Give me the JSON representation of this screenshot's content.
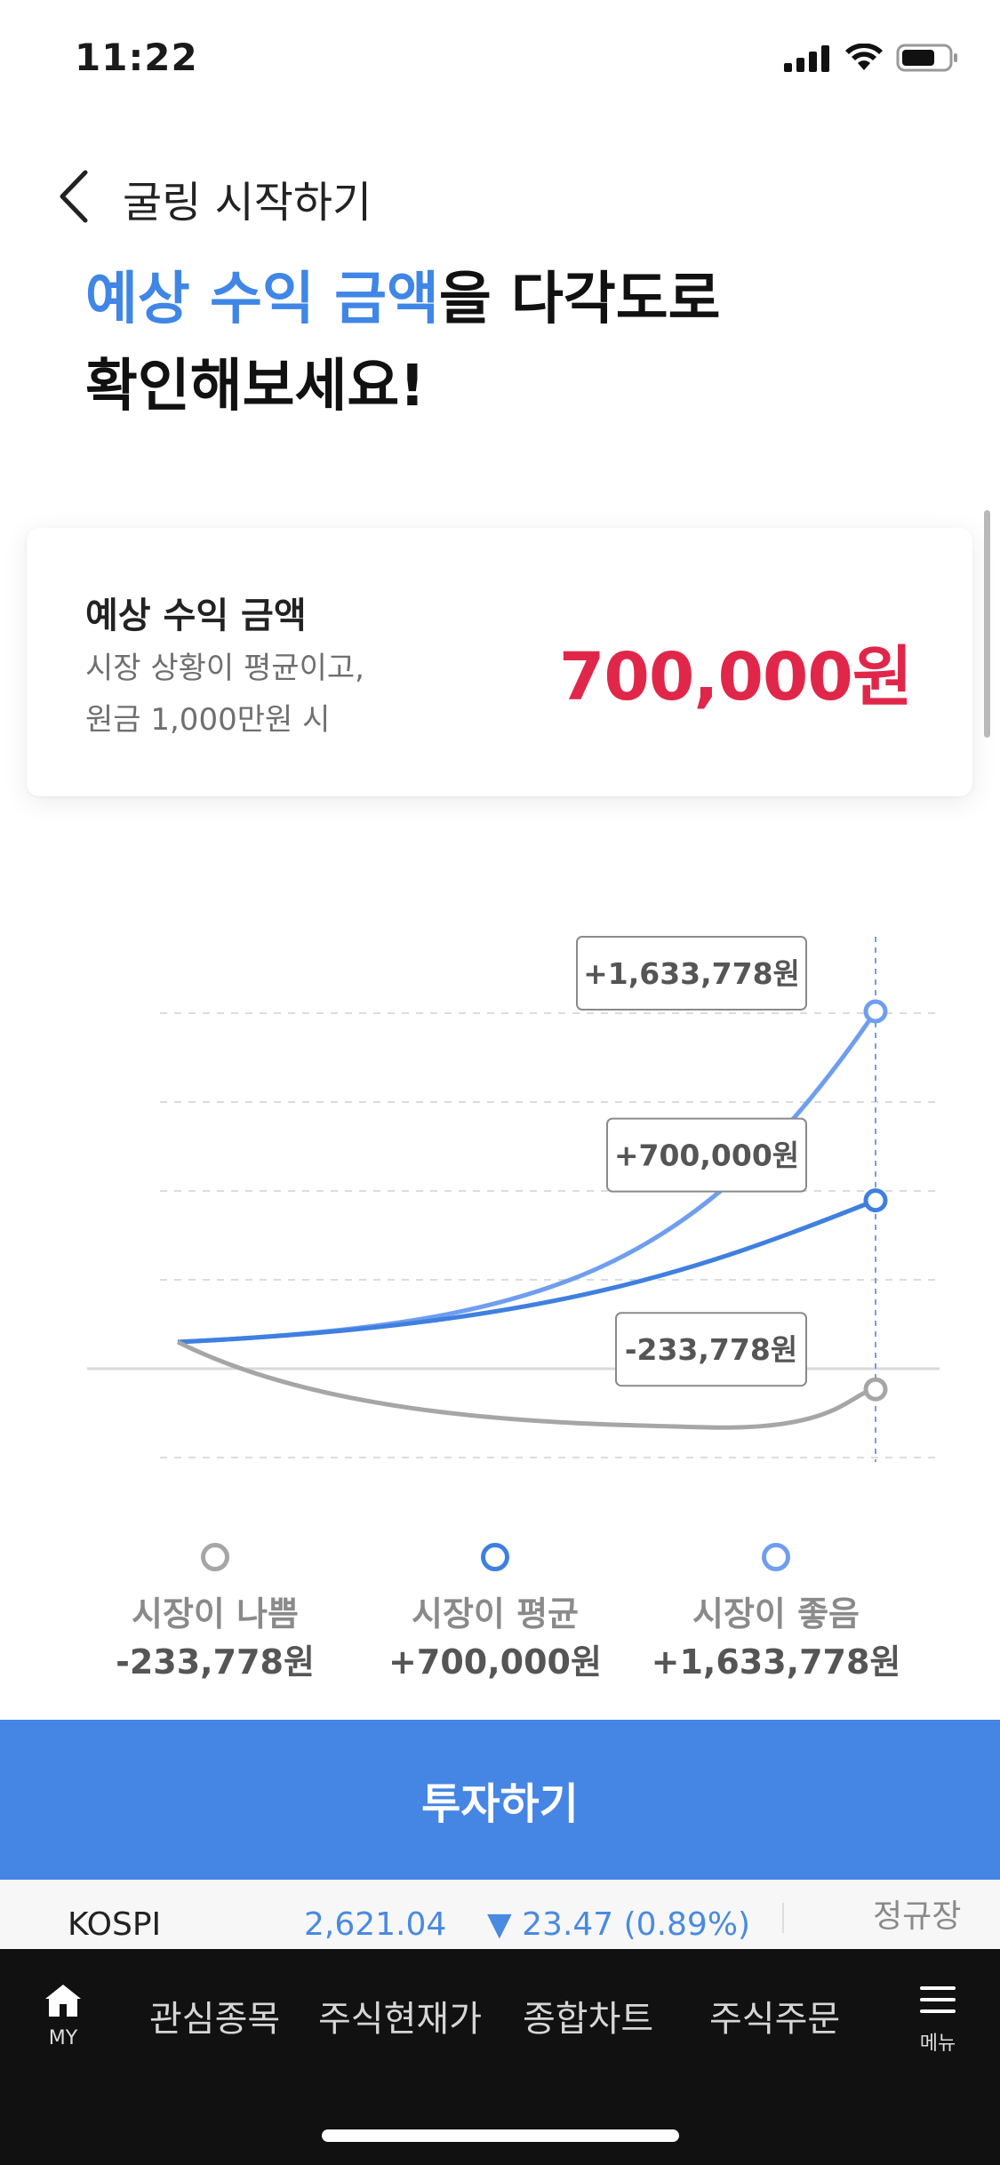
{
  "status": {
    "time": "11:22"
  },
  "header": {
    "title": "굴링 시작하기"
  },
  "headline": {
    "highlight": "예상 수익 금액",
    "rest_line1": "을 다각도로",
    "line2": "확인해보세요!"
  },
  "card": {
    "title": "예상 수익 금액",
    "subtitle_line1": "시장 상황이 평균이고,",
    "subtitle_line2": "원금 1,000만원 시",
    "amount": "700,000원",
    "amount_color": "#e0274a"
  },
  "chart_data": {
    "type": "line",
    "series": [
      {
        "name": "시장이 좋음",
        "final_value": 1633778,
        "label": "+1,633,778원",
        "color": "#6f9ef0"
      },
      {
        "name": "시장이 평균",
        "final_value": 700000,
        "label": "+700,000원",
        "color": "#3f7fe0"
      },
      {
        "name": "시장이 나쁨",
        "final_value": -233778,
        "label": "-233,778원",
        "color": "#a6a6a6"
      }
    ]
  },
  "legend": [
    {
      "name": "시장이 나쁨",
      "value": "-233,778원",
      "color": "#a6a6a6"
    },
    {
      "name": "시장이 평균",
      "value": "+700,000원",
      "color": "#3f7fe0"
    },
    {
      "name": "시장이 좋음",
      "value": "+1,633,778원",
      "color": "#6f9ef0"
    }
  ],
  "invest_button": {
    "label": "투자하기",
    "color": "#4585e3"
  },
  "ticker": {
    "name": "KOSPI",
    "value": "2,621.04",
    "change": "▼ 23.47 (0.89%)",
    "status": "정규장"
  },
  "bottom_nav": {
    "home_label": "MY",
    "items": [
      "관심종목",
      "주식현재가",
      "종합차트",
      "주식주문"
    ],
    "menu_label": "메뉴"
  }
}
